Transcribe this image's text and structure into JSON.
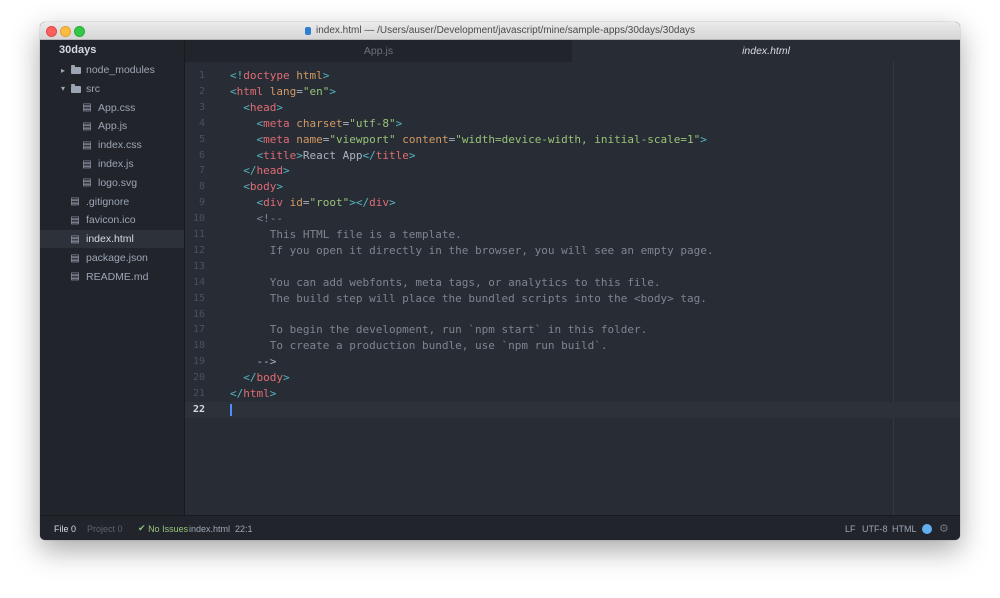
{
  "window": {
    "title": "index.html — /Users/auser/Development/javascript/mine/sample-apps/30days/30days"
  },
  "sidebar": {
    "project": "30days",
    "items": [
      {
        "label": "node_modules",
        "kind": "folder",
        "state": "collapsed",
        "depth": 1
      },
      {
        "label": "src",
        "kind": "folder",
        "state": "expanded",
        "depth": 1
      },
      {
        "label": "App.css",
        "kind": "file",
        "depth": 2
      },
      {
        "label": "App.js",
        "kind": "file",
        "depth": 2
      },
      {
        "label": "index.css",
        "kind": "file",
        "depth": 2
      },
      {
        "label": "index.js",
        "kind": "file",
        "depth": 2
      },
      {
        "label": "logo.svg",
        "kind": "file",
        "depth": 2
      },
      {
        "label": ".gitignore",
        "kind": "file",
        "depth": 1
      },
      {
        "label": "favicon.ico",
        "kind": "file",
        "depth": 1
      },
      {
        "label": "index.html",
        "kind": "file",
        "depth": 1,
        "selected": true
      },
      {
        "label": "package.json",
        "kind": "file",
        "depth": 1
      },
      {
        "label": "README.md",
        "kind": "file",
        "depth": 1
      }
    ]
  },
  "tabs": [
    {
      "label": "App.js",
      "active": false
    },
    {
      "label": "index.html",
      "active": true
    }
  ],
  "editor": {
    "current_line": 22,
    "lines": [
      "<!doctype html>",
      "<html lang=\"en\">",
      "  <head>",
      "    <meta charset=\"utf-8\">",
      "    <meta name=\"viewport\" content=\"width=device-width, initial-scale=1\">",
      "    <title>React App</title>",
      "  </head>",
      "  <body>",
      "    <div id=\"root\"></div>",
      "    <!--",
      "      This HTML file is a template.",
      "      If you open it directly in the browser, you will see an empty page.",
      "",
      "      You can add webfonts, meta tags, or analytics to this file.",
      "      The build step will place the bundled scripts into the <body> tag.",
      "",
      "      To begin the development, run `npm start` in this folder.",
      "      To create a production bundle, use `npm run build`.",
      "    -->",
      "  </body>",
      "</html>",
      ""
    ]
  },
  "statusbar": {
    "file_label": "File",
    "file_count": "0",
    "project_label": "Project",
    "project_count": "0",
    "issues": "No Issues",
    "issues_icon": "check-icon",
    "filename": "index.html",
    "cursor_pos": "22:1",
    "line_ending": "LF",
    "encoding": "UTF-8",
    "grammar": "HTML",
    "icons": [
      "squirrel-icon",
      "gear-icon"
    ]
  },
  "colors": {
    "tag": "#e06c75",
    "bracket": "#56b6c2",
    "attribute": "#d19a66",
    "string": "#98c379",
    "comment": "#7f848e",
    "text": "#abb2bf",
    "accent": "#528bff"
  }
}
